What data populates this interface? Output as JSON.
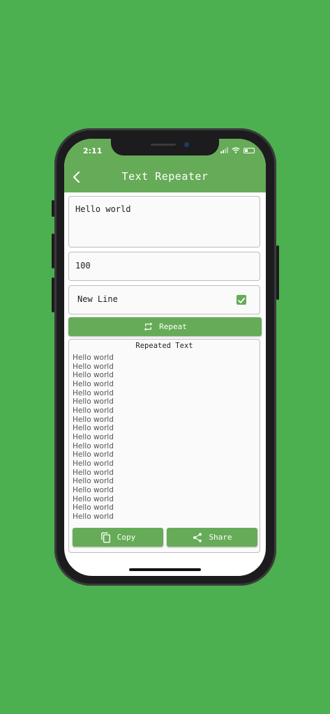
{
  "status": {
    "time": "2:11"
  },
  "header": {
    "title": "Text Repeater"
  },
  "form": {
    "text_value": "Hello world",
    "count_value": "100",
    "new_line_label": "New Line",
    "new_line_checked": true,
    "repeat_label": "Repeat"
  },
  "result": {
    "title": "Repeated Text",
    "line": "Hello world",
    "visible_lines": 19
  },
  "actions": {
    "copy_label": "Copy",
    "share_label": "Share"
  },
  "colors": {
    "background": "#4caf50",
    "accent": "#66ab57"
  }
}
